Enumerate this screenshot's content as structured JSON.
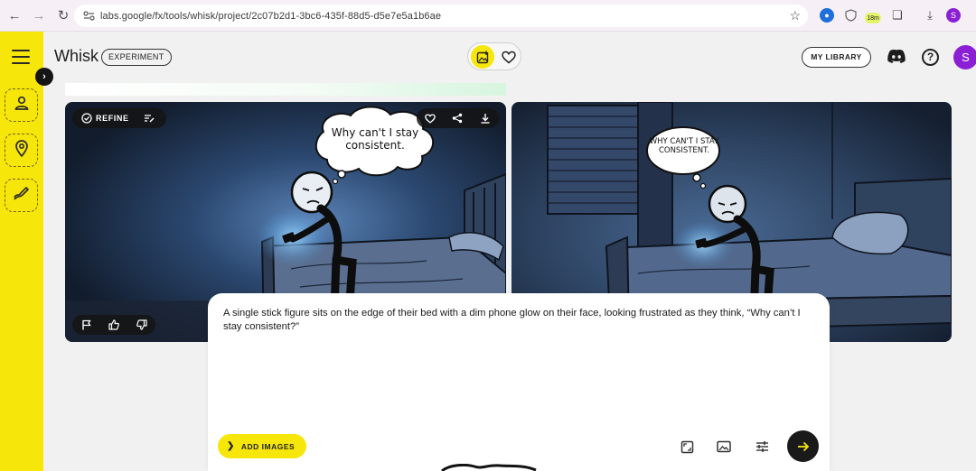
{
  "browser": {
    "url": "labs.google/fx/tools/whisk/project/2c07b2d1-3bc6-435f-88d5-d5e7e5a1b6ae",
    "extension_badge": "18m",
    "profile_initial": "S"
  },
  "app": {
    "title": "Whisk",
    "badge": "EXPERIMENT",
    "library_label": "MY LIBRARY",
    "profile_initial": "S",
    "accent_color": "#f7e60a",
    "profile_color": "#8b1fd6"
  },
  "rail": {
    "items": [
      {
        "icon": "person-icon"
      },
      {
        "icon": "location-pin-icon"
      },
      {
        "icon": "brush-icon"
      }
    ]
  },
  "cards": [
    {
      "refine_label": "REFINE",
      "bubble_text": "Why can't I stay consistent.",
      "actions": [
        "heart-icon",
        "share-icon",
        "download-icon"
      ],
      "feedback": [
        "flag-icon",
        "thumbs-up-icon",
        "thumbs-down-icon"
      ]
    },
    {
      "bubble_text": "WHY CAN'T I STAY CONSISTENT."
    }
  ],
  "prompt": {
    "text": "A single stick figure sits on the edge of their bed with a dim phone glow on their face, looking frustrated as they think, “Why can’t I stay consistent?”",
    "add_images_label": "ADD IMAGES",
    "tools": [
      "aspect-ratio-icon",
      "image-icon",
      "settings-sliders-icon"
    ]
  }
}
